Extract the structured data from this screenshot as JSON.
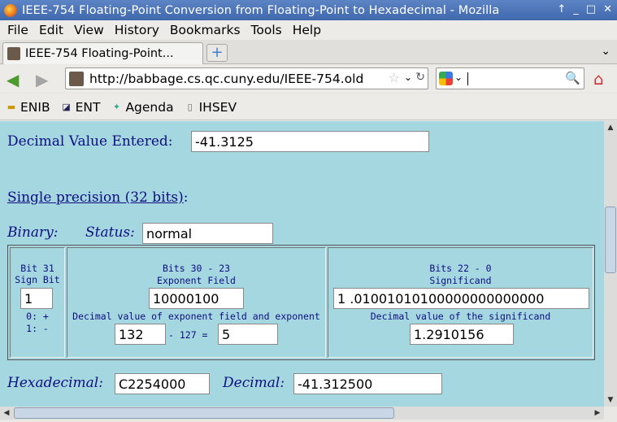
{
  "window": {
    "title": "IEEE-754 Floating-Point Conversion from Floating-Point to Hexadecimal - Mozilla",
    "controls": [
      "↑",
      "_",
      "□",
      "✕"
    ]
  },
  "menu": [
    "File",
    "Edit",
    "View",
    "History",
    "Bookmarks",
    "Tools",
    "Help"
  ],
  "tab": {
    "label": "IEEE-754 Floating-Point...",
    "new_tab": "+",
    "list": "⌄"
  },
  "nav": {
    "url": "http://babbage.cs.qc.cuny.edu/IEEE-754.old",
    "search_value": ""
  },
  "bookmarks": [
    {
      "label": "ENIB",
      "icon": "enib-icon"
    },
    {
      "label": "ENT",
      "icon": "ent-icon"
    },
    {
      "label": "Agenda",
      "icon": "agenda-icon"
    },
    {
      "label": "IHSEV",
      "icon": "page-icon"
    }
  ],
  "page": {
    "decimal_entered_label": "Decimal Value Entered:",
    "decimal_entered_value": "-41.3125",
    "section_link": "Single precision (32 bits)",
    "section_colon": ":",
    "binary_label": "Binary:",
    "status_label": "Status:",
    "status_value": "normal",
    "sign": {
      "header1": "Bit 31",
      "header2": "Sign Bit",
      "value": "1",
      "legend1": "0: +",
      "legend2": "1: -"
    },
    "exponent": {
      "header1": "Bits 30 - 23",
      "header2": "Exponent Field",
      "value": "10000100",
      "caption": "Decimal value of exponent field and exponent",
      "field_decimal": "132",
      "minus_bias": "- 127 =",
      "exponent": "5"
    },
    "significand": {
      "header1": "Bits 22 - 0",
      "header2": "Significand",
      "value": "1 .01001010100000000000000",
      "caption": "Decimal value of the significand",
      "decimal": "1.2910156"
    },
    "hex_label": "Hexadecimal:",
    "hex_value": "C2254000",
    "decimal_label": "Decimal:",
    "decimal_value": "-41.312500"
  },
  "colors": {
    "content_bg": "#a5d7e1",
    "label_text": "#0e0e80",
    "titlebar": "#4a72b6"
  }
}
